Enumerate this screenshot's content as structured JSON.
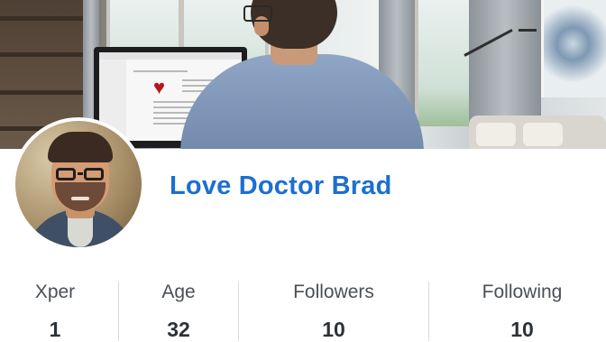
{
  "profile": {
    "name": "Love Doctor Brad"
  },
  "stats": [
    {
      "label": "Xper",
      "value": "1"
    },
    {
      "label": "Age",
      "value": "32"
    },
    {
      "label": "Followers",
      "value": "10"
    },
    {
      "label": "Following",
      "value": "10"
    }
  ],
  "colors": {
    "name_accent": "#1d6fd0",
    "stat_label": "#4a4f57",
    "stat_value": "#2d3238",
    "divider": "#d9dce0"
  }
}
